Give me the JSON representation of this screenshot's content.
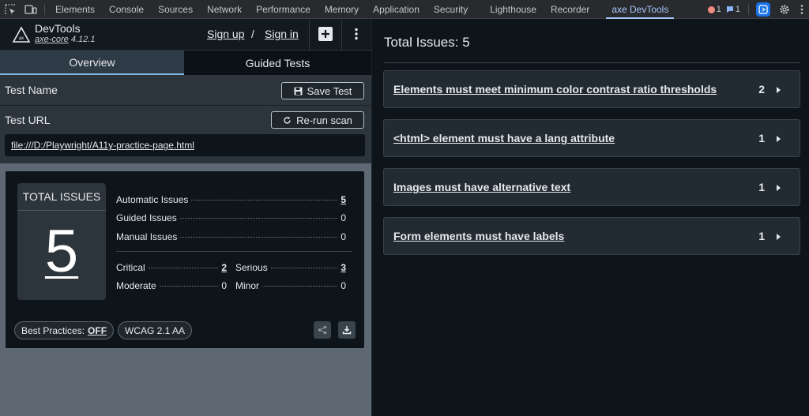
{
  "devtools": {
    "tabs": [
      "Elements",
      "Console",
      "Sources",
      "Network",
      "Performance",
      "Memory",
      "Application",
      "Security",
      "Lighthouse",
      "Recorder",
      "axe DevTools"
    ],
    "active_tab": "axe DevTools",
    "errors_count": "1",
    "messages_count": "1"
  },
  "brand": {
    "title": "DevTools",
    "core_name": "axe-core",
    "core_version": "4.12.1",
    "sign_up": "Sign up",
    "separator": "/",
    "sign_in": "Sign in"
  },
  "tabs": {
    "overview": "Overview",
    "guided": "Guided Tests"
  },
  "form": {
    "test_name_label": "Test Name",
    "save_button": "Save Test",
    "test_url_label": "Test URL",
    "rerun_button": "Re-run scan",
    "url": "file:///D:/Playwright/A11y-practice-page.html"
  },
  "summary": {
    "total_label": "TOTAL ISSUES",
    "total": "5",
    "automatic_label": "Automatic Issues",
    "automatic": "5",
    "guided_label": "Guided Issues",
    "guided": "0",
    "manual_label": "Manual Issues",
    "manual": "0",
    "critical_label": "Critical",
    "critical": "2",
    "serious_label": "Serious",
    "serious": "3",
    "moderate_label": "Moderate",
    "moderate": "0",
    "minor_label": "Minor",
    "minor": "0",
    "best_practices_label": "Best Practices:",
    "best_practices_value": "OFF",
    "standard": "WCAG 2.1 AA"
  },
  "results": {
    "title": "Total Issues: 5",
    "issues": [
      {
        "title": "Elements must meet minimum color contrast ratio thresholds",
        "count": "2"
      },
      {
        "title": "<html> element must have a lang attribute",
        "count": "1"
      },
      {
        "title": "Images must have alternative text",
        "count": "1"
      },
      {
        "title": "Form elements must have labels",
        "count": "1"
      }
    ]
  },
  "colors": {
    "accent": "#a8c7fa",
    "tab_underline": "#7fb6e6",
    "error_red": "#f28b82",
    "message_blue": "#8ab4f8"
  }
}
